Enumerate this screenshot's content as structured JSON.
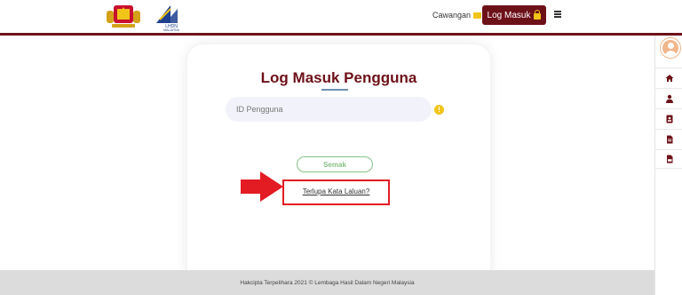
{
  "header": {
    "logo_coat_label": "Jata Negara",
    "logo_lhdn_text": "LHDN",
    "logo_lhdn_sub": "MALAYSIA",
    "cawangan_label": "Cawangan",
    "login_label": "Log Masuk",
    "menu_icon": "hamburger-menu-icon"
  },
  "card": {
    "title": "Log Masuk Pengguna",
    "id_placeholder": "ID Pengguna",
    "info_icon_glyph": "!",
    "semak_label": "Semak",
    "forgot_label": "Terlupa Kata Laluan?"
  },
  "footer": {
    "text": "Hakcipta Terpelihara 2021 © Lembaga Hasil Dalam Negeri Malaysia"
  },
  "sidebar": {
    "icons": [
      "home-icon",
      "user-icon",
      "id-card-icon",
      "document-icon",
      "pdf-icon"
    ]
  },
  "colors": {
    "brand": "#6d1119",
    "accent_yellow": "#f0c419",
    "highlight_red": "#e31b23",
    "semak_green": "#86c286",
    "footer_gray": "#dcdcdc"
  }
}
